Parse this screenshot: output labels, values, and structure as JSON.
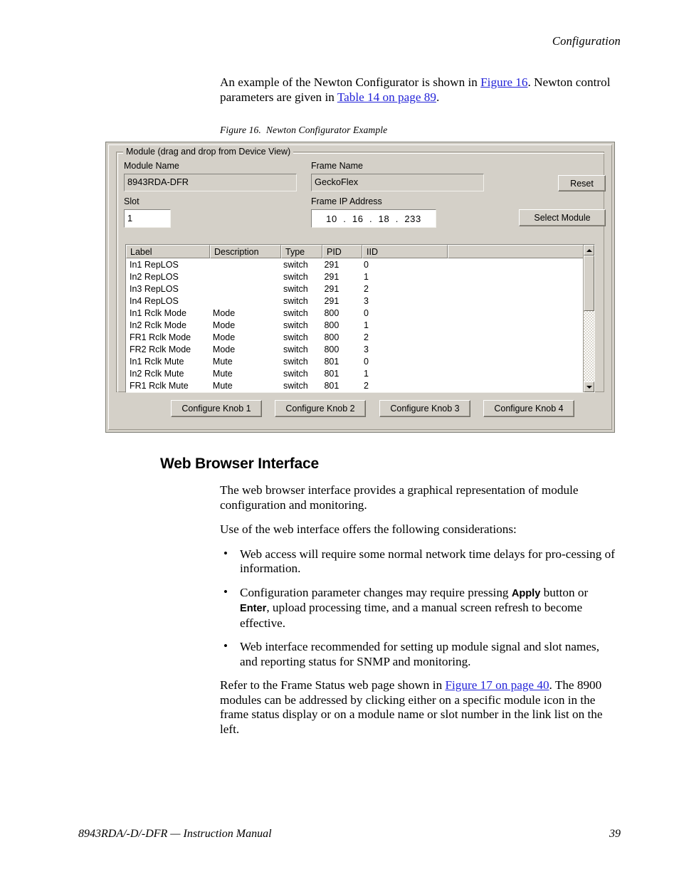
{
  "page": {
    "running_header": "Configuration",
    "footer_left": "8943RDA/-D/-DFR  — Instruction Manual",
    "footer_page_number": "39",
    "link_color": "#2323d8"
  },
  "intro": {
    "text_1": "An example of the Newton Configurator is shown in ",
    "link_1": "Figure 16",
    "text_2": ". Newton control parameters are given in ",
    "link_2": "Table 14 on page 89",
    "text_3": "."
  },
  "figure": {
    "number": "Figure 16.",
    "title": "Newton Configurator Example"
  },
  "dialog": {
    "group_legend": "Module (drag and drop from Device View)",
    "fields": {
      "module_name_label": "Module Name",
      "module_name_value": "8943RDA-DFR",
      "frame_name_label": "Frame Name",
      "frame_name_value": "GeckoFlex",
      "slot_label": "Slot",
      "slot_value": "1",
      "frame_ip_label": "Frame IP Address",
      "frame_ip_value": "10  .  16  .  18  .  233"
    },
    "buttons": {
      "reset": "Reset",
      "select_module": "Select Module",
      "knob1": "Configure Knob 1",
      "knob2": "Configure Knob 2",
      "knob3": "Configure Knob 3",
      "knob4": "Configure Knob 4"
    },
    "table": {
      "columns": [
        "Label",
        "Description",
        "Type",
        "PID",
        "IID",
        ""
      ],
      "rows": [
        [
          "In1 RepLOS",
          "",
          "switch",
          "291",
          "0",
          ""
        ],
        [
          "In2 RepLOS",
          "",
          "switch",
          "291",
          "1",
          ""
        ],
        [
          "In3 RepLOS",
          "",
          "switch",
          "291",
          "2",
          ""
        ],
        [
          "In4 RepLOS",
          "",
          "switch",
          "291",
          "3",
          ""
        ],
        [
          "In1 Rclk Mode",
          "Mode",
          "switch",
          "800",
          "0",
          ""
        ],
        [
          "In2 Rclk Mode",
          "Mode",
          "switch",
          "800",
          "1",
          ""
        ],
        [
          "FR1 Rclk Mode",
          "Mode",
          "switch",
          "800",
          "2",
          ""
        ],
        [
          "FR2 Rclk Mode",
          "Mode",
          "switch",
          "800",
          "3",
          ""
        ],
        [
          "In1 Rclk Mute",
          "Mute",
          "switch",
          "801",
          "0",
          ""
        ],
        [
          "In2 Rclk Mute",
          "Mute",
          "switch",
          "801",
          "1",
          ""
        ],
        [
          "FR1 Rclk Mute",
          "Mute",
          "switch",
          "801",
          "2",
          ""
        ],
        [
          "FR2 Rclk Mute",
          "Mute",
          "switch",
          "801",
          "3",
          ""
        ]
      ]
    },
    "scrollbar": {
      "up_arrow": "scroll-up-arrow",
      "down_arrow": "scroll-down-arrow"
    }
  },
  "section": {
    "heading": "Web Browser Interface",
    "para_1": "The web browser interface provides a graphical representation of module configuration and monitoring.",
    "para_2": "Use of the web interface offers the following considerations:",
    "bullets": [
      {
        "text_1": "Web access will require some normal network time delays for pro-cessing of information.",
        "bold_1": "",
        "text_2": "",
        "bold_2": "",
        "text_3": ""
      },
      {
        "text_1": "Configuration parameter changes may require pressing ",
        "bold_1": "Apply",
        "text_2": " button or ",
        "bold_2": "Enter",
        "text_3": ", upload processing time, and a manual screen refresh to become effective."
      },
      {
        "text_1": "Web interface recommended for setting up module signal and slot names, and reporting status for SNMP and monitoring.",
        "bold_1": "",
        "text_2": "",
        "bold_2": "",
        "text_3": ""
      }
    ],
    "closing": {
      "text_1": "Refer to the Frame Status web page shown in ",
      "link_1": "Figure 17 on page 40",
      "text_2": ". The 8900 modules can be addressed by clicking either on a specific module icon in the frame status display or on a module name or slot number in the link list on the left."
    }
  }
}
